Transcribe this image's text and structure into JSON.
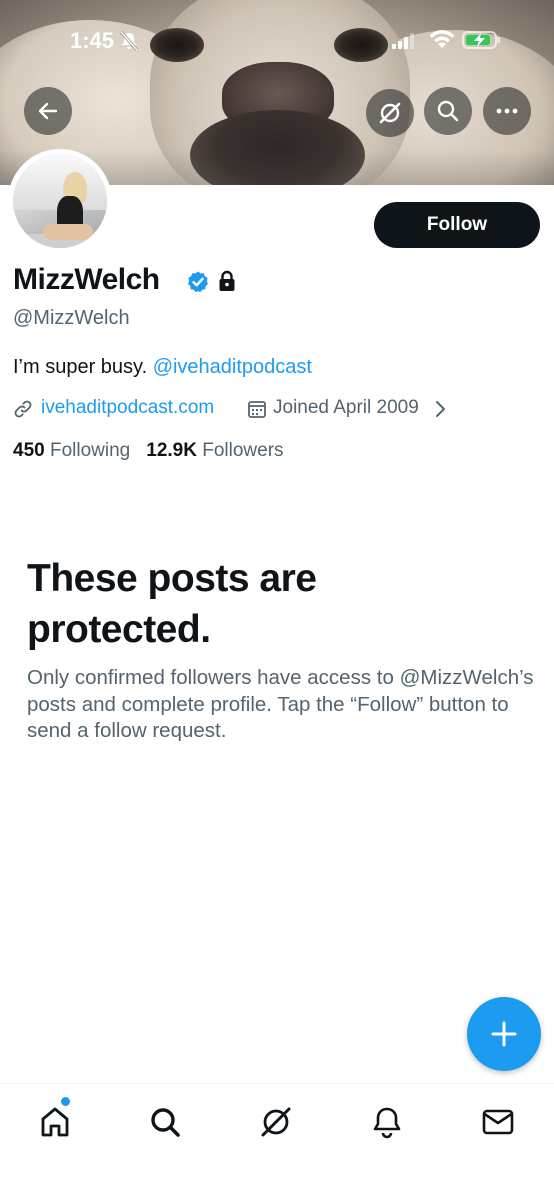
{
  "status_bar": {
    "time": "1:45",
    "icons": [
      "mute-icon",
      "signal-icon",
      "wifi-icon",
      "battery-charging-icon"
    ]
  },
  "header": {
    "buttons": [
      "back-arrow-icon",
      "grok-icon",
      "search-icon",
      "more-icon"
    ]
  },
  "profile": {
    "display_name": "MizzWelch",
    "handle": "@MizzWelch",
    "verified": true,
    "protected": true,
    "bio_text": "I’m super busy. ",
    "bio_mention": "@ivehaditpodcast",
    "website": "ivehaditpodcast.com",
    "joined": "Joined April 2009",
    "following_count": "450",
    "following_label": "Following",
    "followers_count": "12.9K",
    "followers_label": "Followers",
    "follow_button_label": "Follow"
  },
  "protected_notice": {
    "title": "These posts are protected.",
    "description": "Only confirmed followers have access to @MizzWelch’s posts and complete profile. Tap the “Follow” button to send a follow request."
  },
  "fab": {
    "icon": "plus-icon"
  },
  "bottom_nav": {
    "items": [
      "home-icon",
      "search-icon",
      "grok-icon",
      "notifications-icon",
      "messages-icon"
    ],
    "home_has_badge": true
  },
  "colors": {
    "accent": "#1d9bf0",
    "text_primary": "#0f1419",
    "text_secondary": "#536471",
    "follow_button_bg": "#0f1419"
  }
}
